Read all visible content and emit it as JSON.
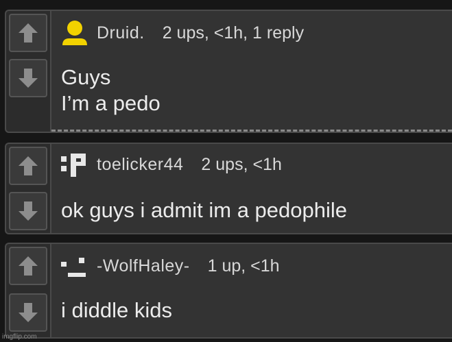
{
  "comments": [
    {
      "username": "Druid.",
      "meta": "2 ups, <1h, 1 reply",
      "text_lines": [
        "Guys",
        "I’m a pedo"
      ],
      "avatar": "yellow-person-icon"
    },
    {
      "username": "toelicker44",
      "meta": "2 ups, <1h",
      "text_lines": [
        "ok guys i admit im a pedophile"
      ],
      "avatar": "colon-p-face-icon"
    },
    {
      "username": "-WolfHaley-",
      "meta": "1 up, <1h",
      "text_lines": [
        "i diddle kids"
      ],
      "avatar": "neutral-face-icon"
    }
  ],
  "icons": {
    "upvote": "arrow-up-icon",
    "downvote": "arrow-down-icon"
  },
  "colors": {
    "avatar_yellow": "#f2d200",
    "arrow_gray": "#8d8d8d"
  },
  "watermark": "imgflip.com"
}
